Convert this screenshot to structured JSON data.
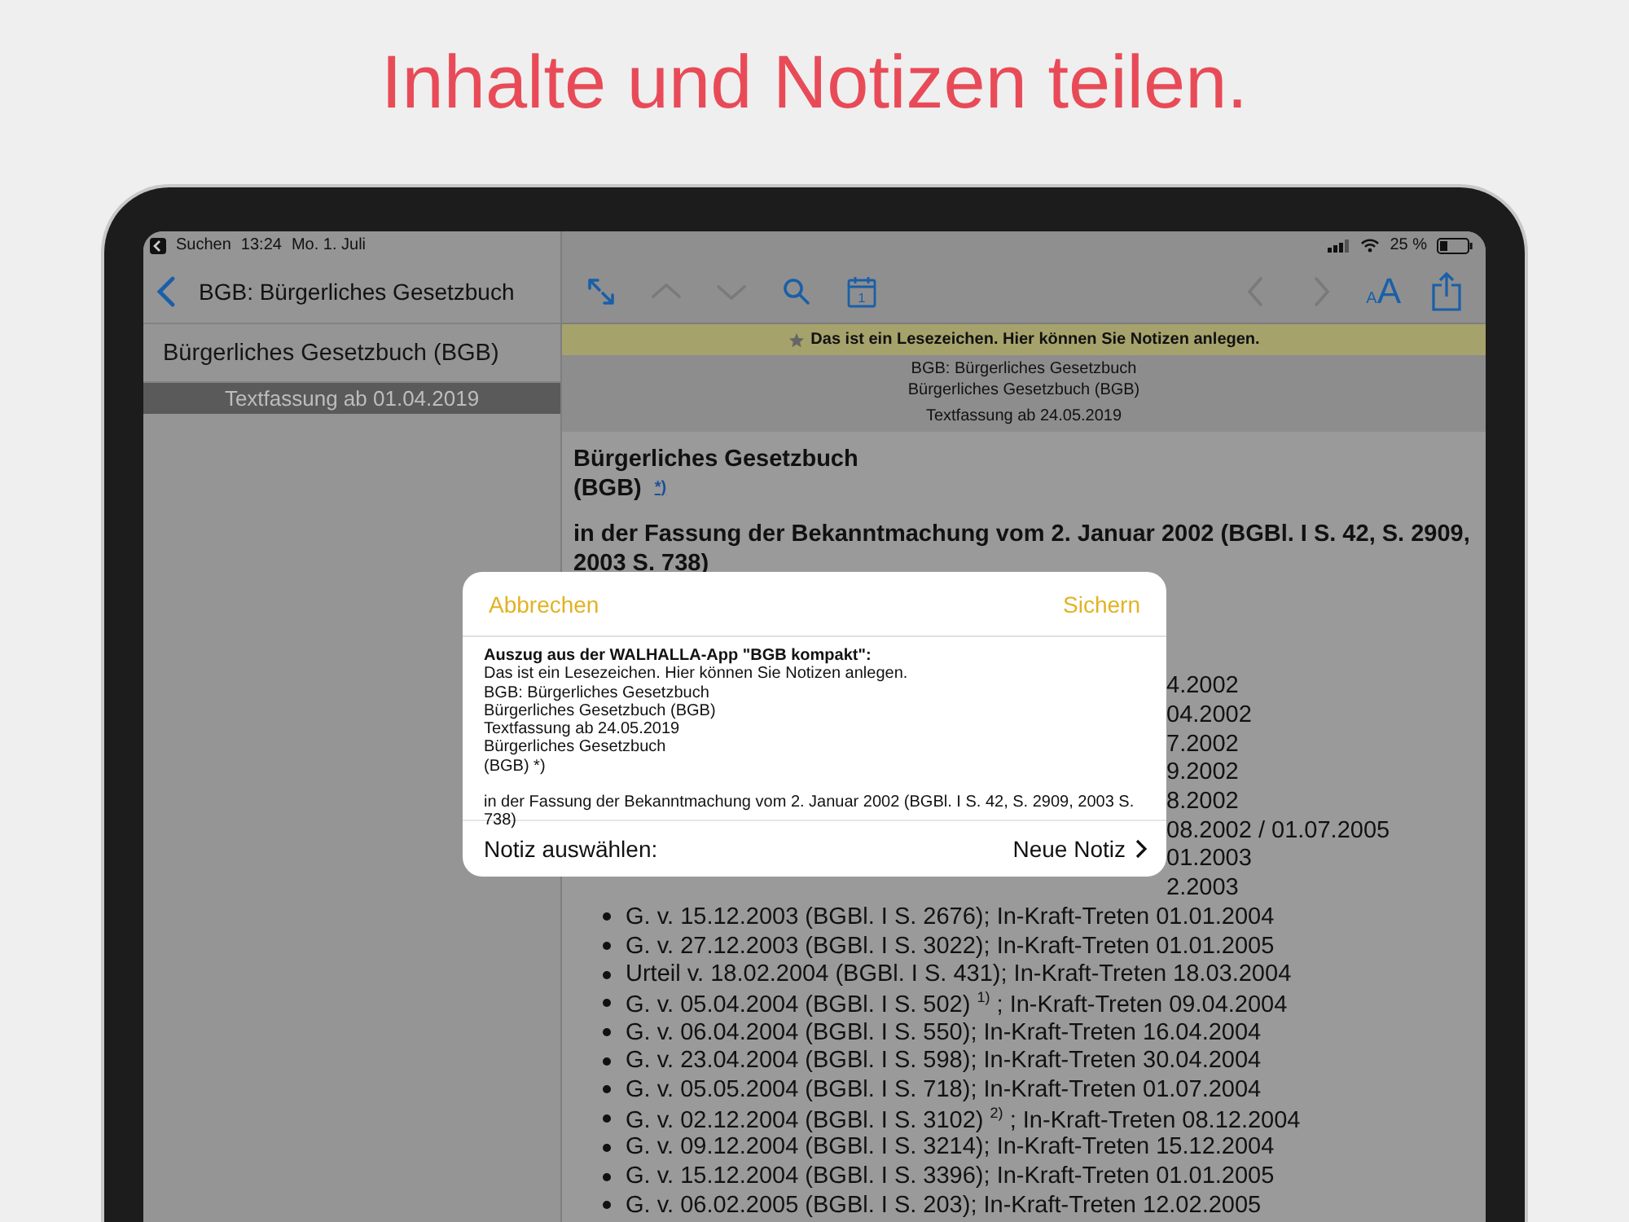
{
  "headline": "Inhalte und Notizen teilen.",
  "status_bar": {
    "back_label": "Suchen",
    "time": "13:24",
    "date": "Mo. 1. Juli",
    "battery": "25 %"
  },
  "sidebar": {
    "title": "BGB: Bürgerliches Gesetzbuch",
    "items": [
      {
        "label": "Bürgerliches Gesetzbuch (BGB)",
        "selected": false
      },
      {
        "label": "Textfassung ab 01.04.2019",
        "selected": true
      }
    ]
  },
  "toolbar": {
    "items": [
      {
        "kind": "expand",
        "disabled": false
      },
      {
        "kind": "up",
        "disabled": true
      },
      {
        "kind": "down",
        "disabled": true
      },
      {
        "kind": "search",
        "disabled": false
      },
      {
        "kind": "calendar",
        "label": "1",
        "disabled": false
      },
      {
        "kind": "spacer"
      },
      {
        "kind": "back",
        "disabled": true
      },
      {
        "kind": "forward",
        "disabled": true
      },
      {
        "kind": "textsize",
        "small": "A",
        "large": "A",
        "disabled": false
      },
      {
        "kind": "share",
        "disabled": false
      }
    ]
  },
  "bookmark_banner": "Das ist ein Lesezeichen. Hier können Sie Notizen anlegen.",
  "document_header": [
    "BGB: Bürgerliches Gesetzbuch",
    "Bürgerliches Gesetzbuch (BGB)",
    "Textfassung ab 24.05.2019"
  ],
  "document": {
    "title_lines": [
      "Bürgerliches Gesetzbuch",
      "(BGB)"
    ],
    "footnote": "*)",
    "subtitle": "in der Fassung der Bekanntmachung vom 2. Januar 2002 (BGBl. I S. 42, S. 2909, 2003 S. 738)",
    "list": [
      {
        "kind": "partial",
        "text": "4.2002"
      },
      {
        "kind": "partial",
        "text": "04.2002"
      },
      {
        "kind": "partial",
        "text": "7.2002"
      },
      {
        "kind": "partial",
        "text": "9.2002"
      },
      {
        "kind": "partial",
        "text": "8.2002"
      },
      {
        "kind": "partial",
        "text": "08.2002 / 01.07.2005"
      },
      {
        "kind": "partial",
        "text": "01.2003"
      },
      {
        "kind": "partial",
        "text": "2.2003"
      },
      {
        "kind": "full",
        "text": "G. v. 15.12.2003 (BGBl. I S. 2676); In-Kraft-Treten 01.01.2004"
      },
      {
        "kind": "full",
        "text": "G. v. 27.12.2003 (BGBl. I S. 3022); In-Kraft-Treten 01.01.2005"
      },
      {
        "kind": "full",
        "text": "Urteil v. 18.02.2004 (BGBl. I S. 431); In-Kraft-Treten 18.03.2004"
      },
      {
        "kind": "full",
        "text": "G. v. 05.04.2004 (BGBl. I S. 502)  $^{1)}$ ; In-Kraft-Treten 09.04.2004"
      },
      {
        "kind": "full",
        "text": "G. v. 06.04.2004 (BGBl. I S. 550); In-Kraft-Treten 16.04.2004"
      },
      {
        "kind": "full",
        "text": "G. v. 23.04.2004 (BGBl. I S. 598); In-Kraft-Treten 30.04.2004"
      },
      {
        "kind": "full",
        "text": "G. v. 05.05.2004 (BGBl. I S. 718); In-Kraft-Treten 01.07.2004"
      },
      {
        "kind": "full",
        "text": "G. v. 02.12.2004 (BGBl. I S. 3102)  $^{2)}$ ; In-Kraft-Treten 08.12.2004"
      },
      {
        "kind": "full",
        "text": "G. v. 09.12.2004 (BGBl. I S. 3214); In-Kraft-Treten 15.12.2004"
      },
      {
        "kind": "full",
        "text": "G. v. 15.12.2004 (BGBl. I S. 3396); In-Kraft-Treten 01.01.2005"
      },
      {
        "kind": "full",
        "text": "G. v. 06.02.2005 (BGBl. I S. 203); In-Kraft-Treten 12.02.2005"
      }
    ]
  },
  "dialog": {
    "cancel": "Abbrechen",
    "save": "Sichern",
    "excerpt_heading": "Auszug aus der WALHALLA-App \"BGB kompakt\":",
    "excerpt_lines": [
      "Das ist ein Lesezeichen. Hier können Sie Notizen anlegen.",
      "BGB: Bürgerliches Gesetzbuch",
      "Bürgerliches Gesetzbuch (BGB)",
      "Textfassung ab 24.05.2019",
      "Bürgerliches Gesetzbuch",
      "(BGB)  *)"
    ],
    "excerpt_paragraph": "in der Fassung der Bekanntmachung vom 2. Januar 2002 (BGBl. I S. 42, S. 2909, 2003 S. 738)",
    "note_label": "Notiz auswählen:",
    "note_value": "Neue Notiz"
  }
}
